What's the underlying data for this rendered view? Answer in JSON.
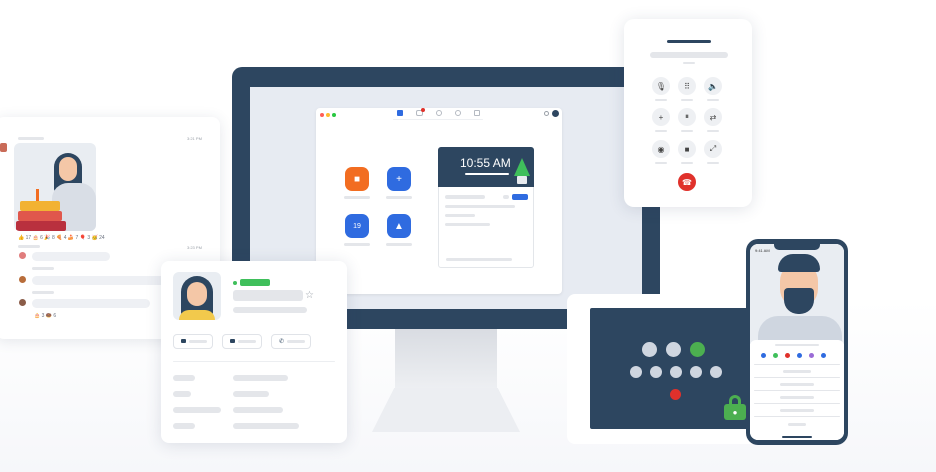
{
  "monitor": {
    "clock": "10:55 AM",
    "window_tabs": [
      "home",
      "chat",
      "phone",
      "meetings",
      "contacts"
    ],
    "app_tiles": [
      {
        "name": "new-meeting-tile",
        "icon": "video-camera-icon",
        "color": "#f26d21"
      },
      {
        "name": "join-tile",
        "icon": "plus-icon",
        "color": "#2f6be0"
      },
      {
        "name": "schedule-tile",
        "icon": "calendar-icon",
        "color": "#2f6be0"
      },
      {
        "name": "share-screen-tile",
        "icon": "share-icon",
        "color": "#2f6be0"
      }
    ],
    "calendar_day": "19"
  },
  "chat": {
    "timestamp_1": "3:21 PM",
    "timestamp_2": "3:23 PM",
    "reactions": "👍 17  🎂 6  🎉 8  🍕 4  🍰 7  🎈 3  🥳 24",
    "reactions_2": "🎂 3  🍩 6"
  },
  "contact_card": {
    "status_color": "#3fbf5b",
    "star_icon": "star-icon",
    "actions": [
      "chat-icon",
      "video-icon",
      "phone-icon"
    ]
  },
  "dialer": {
    "keys": [
      {
        "name": "mute-key",
        "glyph": "🎙"
      },
      {
        "name": "keypad-key",
        "glyph": "⠿"
      },
      {
        "name": "speaker-key",
        "glyph": "🔈"
      },
      {
        "name": "add-call-key",
        "glyph": "+"
      },
      {
        "name": "hold-key",
        "glyph": "⏸"
      },
      {
        "name": "transfer-key",
        "glyph": "⇄"
      },
      {
        "name": "record-key",
        "glyph": "◉"
      },
      {
        "name": "video-key",
        "glyph": "■"
      },
      {
        "name": "expand-key",
        "glyph": "⤢"
      }
    ],
    "hangup_color": "#e0312b"
  },
  "room": {
    "accent_green": "#4caf50",
    "end_color": "#e0312b"
  },
  "phone": {
    "time": "9:41 AM"
  }
}
